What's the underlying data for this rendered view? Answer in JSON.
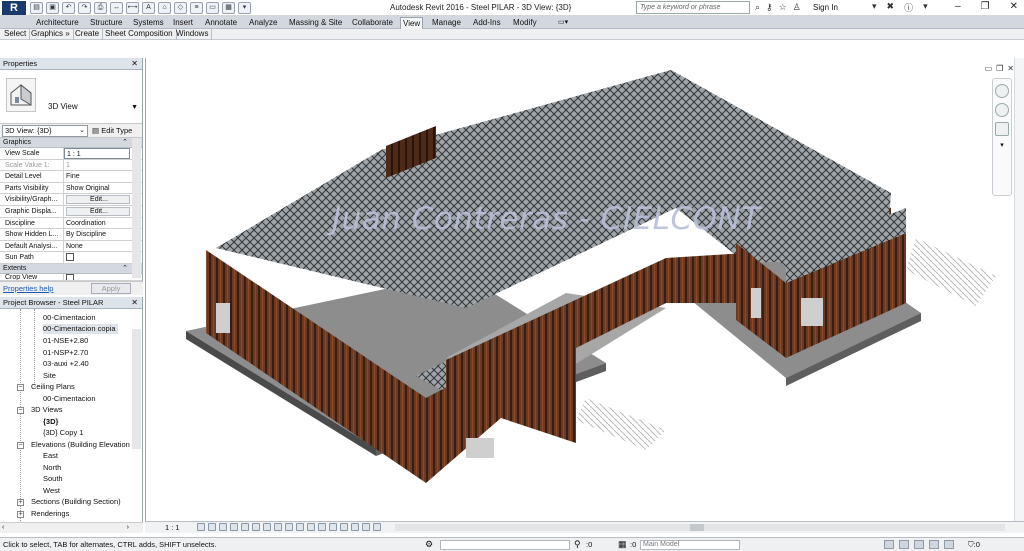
{
  "app": {
    "logo": "R",
    "title": "Autodesk Revit 2016 -    Steel PILAR - 3D View: {3D}",
    "search_placeholder": "Type a keyword or phrase",
    "sign_in": "Sign In"
  },
  "ribbon": {
    "tabs": [
      "Architecture",
      "Structure",
      "Systems",
      "Insert",
      "Annotate",
      "Analyze",
      "Massing & Site",
      "Collaborate",
      "View",
      "Manage",
      "Add-Ins",
      "Modify"
    ],
    "active_tab": "View",
    "panels": [
      "Select",
      "Graphics",
      "Create",
      "Sheet Composition",
      "Windows"
    ]
  },
  "properties": {
    "title": "Properties",
    "type_name": "3D View",
    "filter_value": "3D View: {3D}",
    "edit_type": "Edit Type",
    "groups": {
      "graphics": "Graphics",
      "extents": "Extents"
    },
    "rows": [
      {
        "key": "View Scale",
        "value": "1 : 1"
      },
      {
        "key": "Scale Value    1:",
        "value": "1"
      },
      {
        "key": "Detail Level",
        "value": "Fine"
      },
      {
        "key": "Parts Visibility",
        "value": "Show Original"
      },
      {
        "key": "Visibility/Graph...",
        "value": "Edit..."
      },
      {
        "key": "Graphic Displa...",
        "value": "Edit..."
      },
      {
        "key": "Discipline",
        "value": "Coordination"
      },
      {
        "key": "Show Hidden L...",
        "value": "By Discipline"
      },
      {
        "key": "Default Analysi...",
        "value": "None"
      },
      {
        "key": "Sun Path",
        "value": ""
      }
    ],
    "extents_row": "Crop View",
    "help_link": "Properties help",
    "apply_label": "Apply"
  },
  "browser": {
    "title": "Project Browser - Steel PILAR",
    "items": [
      "00-Cimentacion",
      "00-Cimentacion copia",
      "01-NSE+2.80",
      "01-NSP+2.70",
      "03-auxi +2.40",
      "Site",
      "Ceiling Plans",
      "00-Cimentacion",
      "3D Views",
      "{3D}",
      "{3D} Copy 1",
      "Elevations (Building Elevation",
      "East",
      "North",
      "South",
      "West",
      "Sections (Building Section)",
      "Renderings"
    ]
  },
  "viewport": {
    "watermark": "Juan Contreras - CIELCONT"
  },
  "view_control": {
    "scale": "1 : 1"
  },
  "status": {
    "message": "Click to select, TAB for alternates, CTRL adds, SHIFT unselects.",
    "count1": ":0",
    "count2": ":0",
    "model": "Main Model",
    "filter_count": ":0"
  }
}
